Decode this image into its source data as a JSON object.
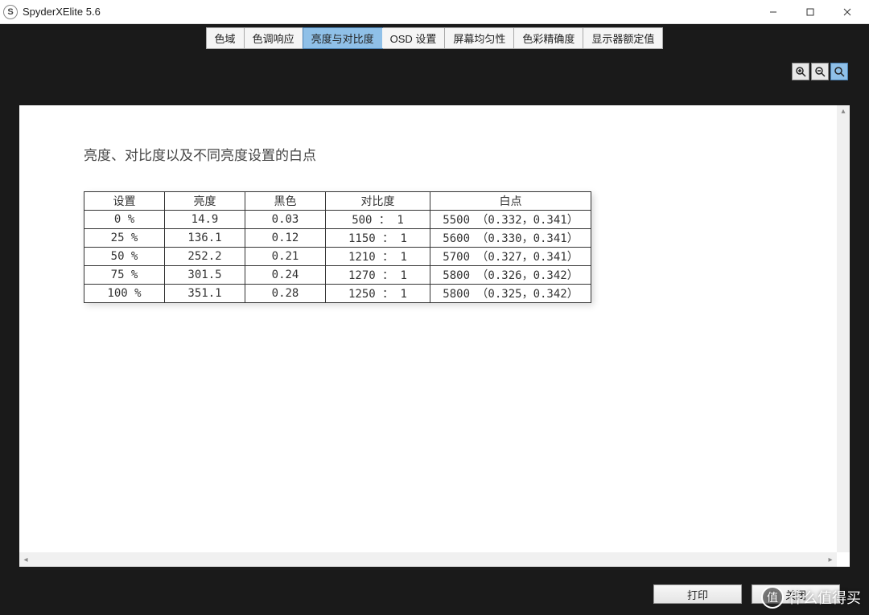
{
  "window": {
    "title": "SpyderXElite 5.6",
    "icon_letter": "S"
  },
  "tabs": [
    {
      "label": "色域",
      "key": "gamut"
    },
    {
      "label": "色调响应",
      "key": "tone"
    },
    {
      "label": "亮度与对比度",
      "key": "brightness",
      "active": true
    },
    {
      "label": "OSD 设置",
      "key": "osd"
    },
    {
      "label": "屏幕均匀性",
      "key": "uniformity"
    },
    {
      "label": "色彩精确度",
      "key": "accuracy"
    },
    {
      "label": "显示器额定值",
      "key": "rating"
    }
  ],
  "zoom_icons": [
    "zoom-in-icon",
    "zoom-out-icon",
    "zoom-fit-icon"
  ],
  "page": {
    "title": "亮度、对比度以及不同亮度设置的白点",
    "columns": {
      "setting": "设置",
      "brightness": "亮度",
      "black": "黑色",
      "contrast": "对比度",
      "whitepoint": "白点"
    }
  },
  "chart_data": {
    "type": "table",
    "title": "亮度、对比度以及不同亮度设置的白点",
    "columns": [
      "设置",
      "亮度",
      "黑色",
      "对比度",
      "白点"
    ],
    "rows": [
      {
        "setting": "0 %",
        "brightness": "14.9",
        "black": "0.03",
        "contrast": "500  ： 1",
        "whitepoint": "5500 （0.332，0.341）"
      },
      {
        "setting": "25 %",
        "brightness": "136.1",
        "black": "0.12",
        "contrast": "1150 ： 1",
        "whitepoint": "5600 （0.330，0.341）"
      },
      {
        "setting": "50 %",
        "brightness": "252.2",
        "black": "0.21",
        "contrast": "1210 ： 1",
        "whitepoint": "5700 （0.327，0.341）"
      },
      {
        "setting": "75 %",
        "brightness": "301.5",
        "black": "0.24",
        "contrast": "1270 ： 1",
        "whitepoint": "5800 （0.326，0.342）"
      },
      {
        "setting": "100 %",
        "brightness": "351.1",
        "black": "0.28",
        "contrast": "1250 ： 1",
        "whitepoint": "5800 （0.325，0.342）"
      }
    ]
  },
  "footer": {
    "print_label": "打印",
    "close_label": "关闭"
  },
  "watermark": {
    "circle": "值",
    "text": "什么值得买"
  }
}
